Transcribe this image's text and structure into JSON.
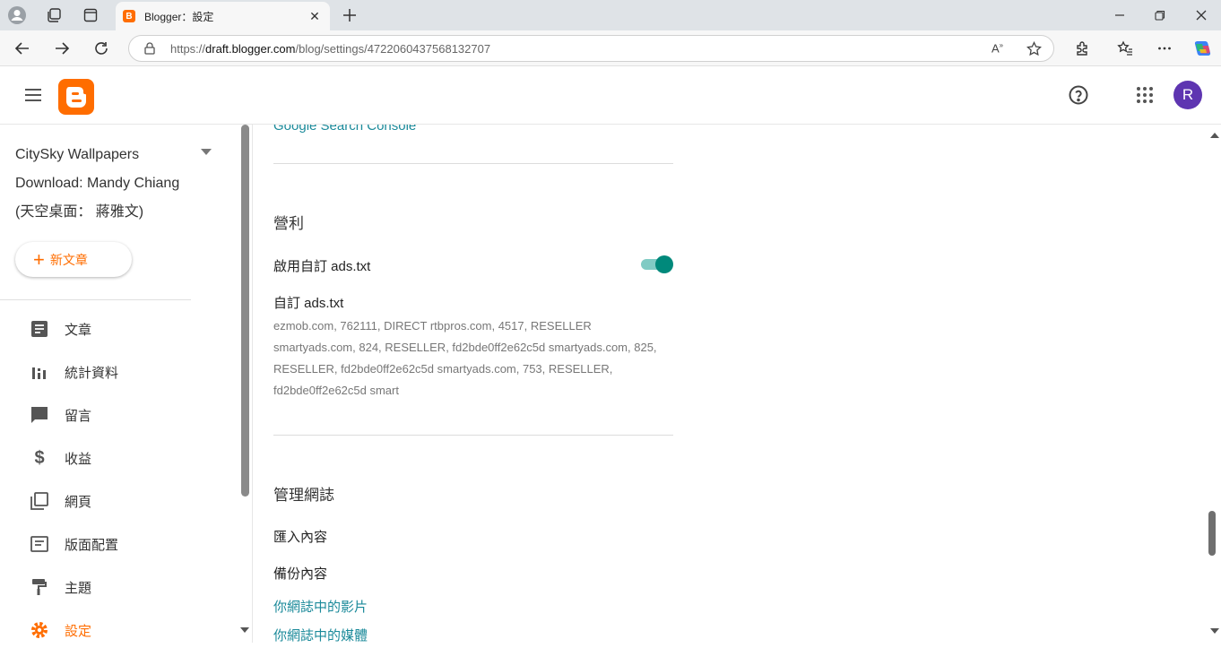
{
  "browser": {
    "tab_title": "Blogger：設定",
    "url_prefix": "https://",
    "url_host": "draft.blogger.com",
    "url_path": "/blog/settings/4722060437568132707"
  },
  "header": {
    "avatar_letter": "R",
    "brand_color": "#ff6d00"
  },
  "sidebar": {
    "blog_name_line1": "CitySky Wallpapers",
    "blog_name_line2": "Download: Mandy Chiang",
    "blog_name_line3": "(天空桌面： 蔣雅文)",
    "new_post_label": "新文章",
    "items": [
      {
        "label": "文章",
        "icon": "posts-icon"
      },
      {
        "label": "統計資料",
        "icon": "stats-icon"
      },
      {
        "label": "留言",
        "icon": "comments-icon"
      },
      {
        "label": "收益",
        "icon": "earnings-icon"
      },
      {
        "label": "網頁",
        "icon": "pages-icon"
      },
      {
        "label": "版面配置",
        "icon": "layout-icon"
      },
      {
        "label": "主題",
        "icon": "theme-icon"
      },
      {
        "label": "設定",
        "icon": "settings-icon"
      }
    ]
  },
  "main": {
    "search_console_link": "Google Search Console",
    "monetization": {
      "title": "營利",
      "enable_custom_ads_label": "啟用自訂 ads.txt",
      "enable_custom_ads_on": true,
      "custom_ads_label": "自訂 ads.txt",
      "custom_ads_value": "ezmob.com, 762111, DIRECT rtbpros.com, 4517, RESELLER smartyads.com, 824, RESELLER, fd2bde0ff2e62c5d smartyads.com, 825, RESELLER, fd2bde0ff2e62c5d smartyads.com, 753, RESELLER, fd2bde0ff2e62c5d smart"
    },
    "manage": {
      "title": "管理網誌",
      "import_label": "匯入內容",
      "backup_label": "備份內容",
      "videos_link": "你網誌中的影片",
      "media_link": "你網誌中的媒體"
    }
  }
}
